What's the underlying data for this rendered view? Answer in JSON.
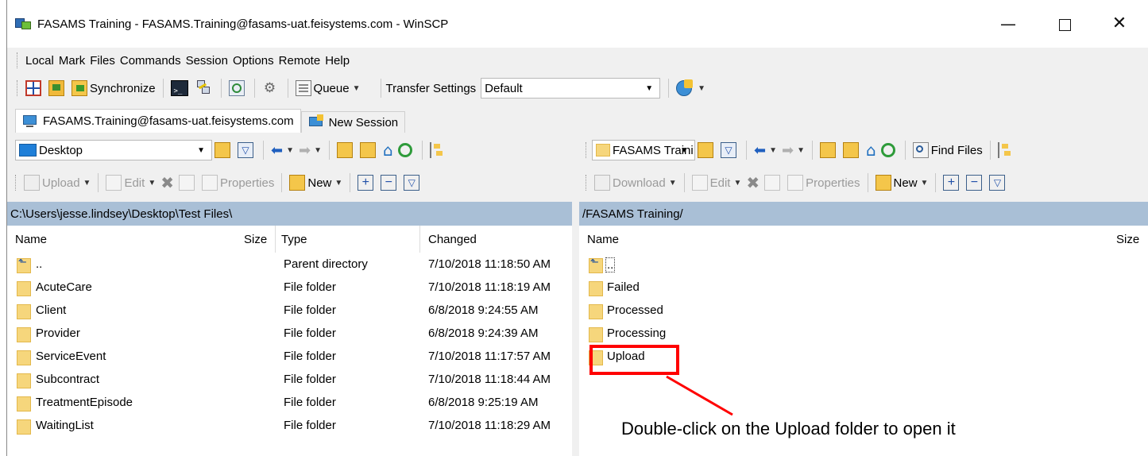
{
  "window": {
    "title": "FASAMS Training - FASAMS.Training@fasams-uat.feisystems.com - WinSCP",
    "min": "—",
    "max": "",
    "close": "✕"
  },
  "menu": [
    "Local",
    "Mark",
    "Files",
    "Commands",
    "Session",
    "Options",
    "Remote",
    "Help"
  ],
  "toolbar": {
    "synchronize": "Synchronize",
    "queue": "Queue",
    "transfer_settings_label": "Transfer Settings",
    "transfer_settings_value": "Default"
  },
  "tabs": {
    "session": "FASAMS.Training@fasams-uat.feisystems.com",
    "new_session": "New Session"
  },
  "local": {
    "location": "Desktop",
    "upload": "Upload",
    "edit": "Edit",
    "properties": "Properties",
    "new": "New",
    "path": "C:\\Users\\jesse.lindsey\\Desktop\\Test Files\\",
    "columns": {
      "name": "Name",
      "size": "Size",
      "type": "Type",
      "changed": "Changed"
    },
    "rows": [
      {
        "name": "..",
        "type": "Parent directory",
        "changed": "7/10/2018  11:18:50 AM"
      },
      {
        "name": "AcuteCare",
        "type": "File folder",
        "changed": "7/10/2018  11:18:19 AM"
      },
      {
        "name": "Client",
        "type": "File folder",
        "changed": "6/8/2018  9:24:55 AM"
      },
      {
        "name": "Provider",
        "type": "File folder",
        "changed": "6/8/2018  9:24:39 AM"
      },
      {
        "name": "ServiceEvent",
        "type": "File folder",
        "changed": "7/10/2018  11:17:57 AM"
      },
      {
        "name": "Subcontract",
        "type": "File folder",
        "changed": "7/10/2018  11:18:44 AM"
      },
      {
        "name": "TreatmentEpisode",
        "type": "File folder",
        "changed": "6/8/2018  9:25:19 AM"
      },
      {
        "name": "WaitingList",
        "type": "File folder",
        "changed": "7/10/2018  11:18:29 AM"
      }
    ]
  },
  "remote": {
    "location": "FASAMS Traini",
    "find_files": "Find Files",
    "download": "Download",
    "edit": "Edit",
    "properties": "Properties",
    "new": "New",
    "path": "/FASAMS Training/",
    "columns": {
      "name": "Name",
      "size": "Size"
    },
    "rows": [
      {
        "name": ".."
      },
      {
        "name": "Failed"
      },
      {
        "name": "Processed"
      },
      {
        "name": "Processing"
      },
      {
        "name": "Upload"
      }
    ]
  },
  "annotation": {
    "text": "Double-click on the Upload folder to open it",
    "color": "#ff0000"
  }
}
